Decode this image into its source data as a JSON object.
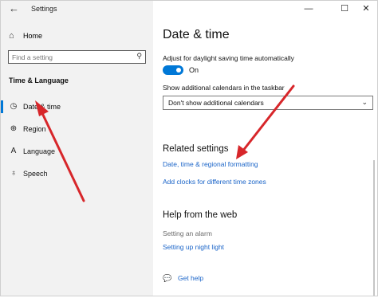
{
  "window": {
    "title": "Settings",
    "back_glyph": "←",
    "minimize_glyph": "—",
    "maximize_glyph": "☐",
    "close_glyph": "✕"
  },
  "sidebar": {
    "home_label": "Home",
    "home_icon": "home-icon",
    "search_placeholder": "Find a setting",
    "group_title": "Time & Language",
    "items": [
      {
        "label": "Date & time",
        "icon": "calendar-clock-icon",
        "active": true
      },
      {
        "label": "Region",
        "icon": "globe-icon",
        "active": false
      },
      {
        "label": "Language",
        "icon": "language-icon",
        "active": false
      },
      {
        "label": "Speech",
        "icon": "microphone-icon",
        "active": false
      }
    ]
  },
  "main": {
    "title": "Date & time",
    "dst_label": "Adjust for daylight saving time automatically",
    "dst_toggle_state": "On",
    "calendars_label": "Show additional calendars in the taskbar",
    "calendars_value": "Don't show additional calendars",
    "related_title": "Related settings",
    "related_links": [
      "Date, time & regional formatting",
      "Add clocks for different time zones"
    ],
    "help_title": "Help from the web",
    "help_links": [
      "Setting an alarm",
      "Setting up night light"
    ],
    "get_help_label": "Get help"
  },
  "colors": {
    "accent": "#0078d7",
    "link": "#1a64c8",
    "sidebar_bg": "#f2f2f2",
    "annotation_arrow": "#d7262a"
  }
}
